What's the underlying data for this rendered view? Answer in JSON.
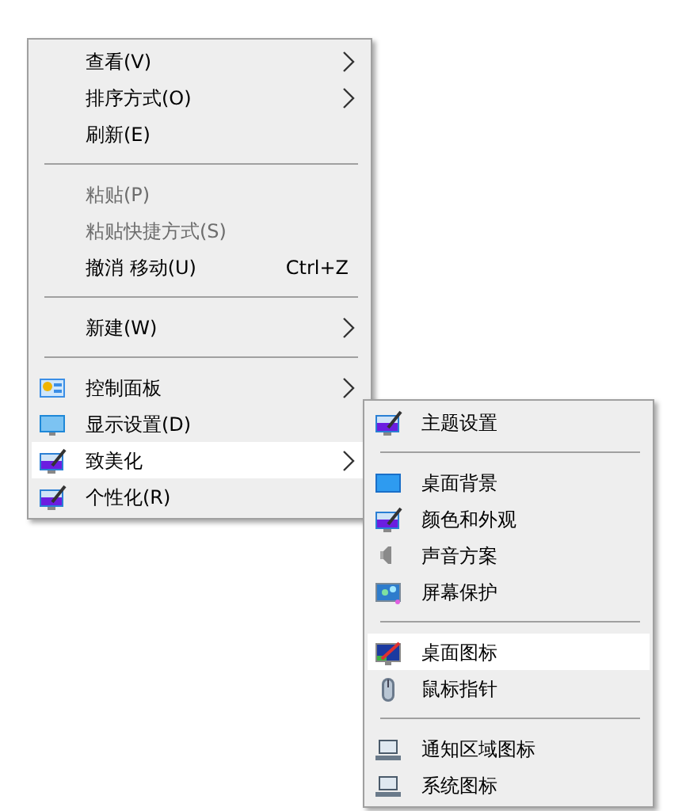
{
  "menu": {
    "items": [
      {
        "kind": "item",
        "label": "查看(V)",
        "disabled": false,
        "submenu": true,
        "selected": false
      },
      {
        "kind": "item",
        "label": "排序方式(O)",
        "disabled": false,
        "submenu": true,
        "selected": false
      },
      {
        "kind": "item",
        "label": "刷新(E)",
        "disabled": false,
        "submenu": false,
        "selected": false
      },
      {
        "kind": "separator"
      },
      {
        "kind": "item",
        "label": "粘贴(P)",
        "disabled": true,
        "submenu": false,
        "selected": false
      },
      {
        "kind": "item",
        "label": "粘贴快捷方式(S)",
        "disabled": true,
        "submenu": false,
        "selected": false
      },
      {
        "kind": "item",
        "label": "撤消 移动(U)",
        "shortcut": "Ctrl+Z",
        "disabled": false,
        "submenu": false,
        "selected": false
      },
      {
        "kind": "separator"
      },
      {
        "kind": "item",
        "label": "新建(W)",
        "disabled": false,
        "submenu": true,
        "selected": false
      },
      {
        "kind": "separator"
      },
      {
        "kind": "item",
        "label": "控制面板",
        "disabled": false,
        "submenu": true,
        "selected": false
      },
      {
        "kind": "item",
        "label": "显示设置(D)",
        "disabled": false,
        "submenu": false,
        "selected": false
      },
      {
        "kind": "item",
        "label": "致美化",
        "disabled": false,
        "submenu": true,
        "selected": true
      },
      {
        "kind": "item",
        "label": "个性化(R)",
        "disabled": false,
        "submenu": false,
        "selected": false
      }
    ]
  },
  "submenu": {
    "items": [
      {
        "kind": "item",
        "label": "主题设置",
        "selected": false
      },
      {
        "kind": "separator"
      },
      {
        "kind": "item",
        "label": "桌面背景",
        "selected": false
      },
      {
        "kind": "item",
        "label": "颜色和外观",
        "selected": false
      },
      {
        "kind": "item",
        "label": "声音方案",
        "selected": false
      },
      {
        "kind": "item",
        "label": "屏幕保护",
        "selected": false
      },
      {
        "kind": "separator"
      },
      {
        "kind": "item",
        "label": "桌面图标",
        "selected": true
      },
      {
        "kind": "item",
        "label": "鼠标指针",
        "selected": false
      },
      {
        "kind": "separator"
      },
      {
        "kind": "item",
        "label": "通知区域图标",
        "selected": false
      },
      {
        "kind": "item",
        "label": "系统图标",
        "selected": false
      }
    ]
  }
}
